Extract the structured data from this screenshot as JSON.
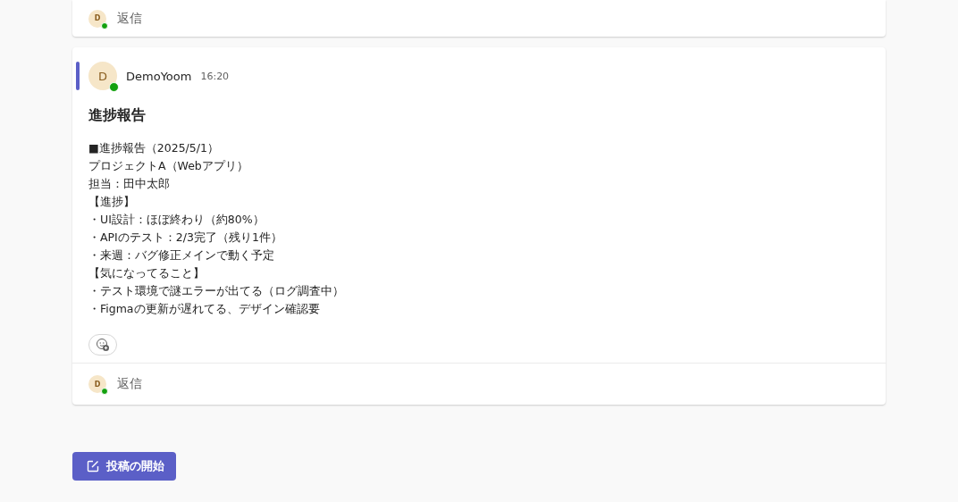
{
  "threads": [
    {
      "partial": true,
      "reply": {
        "avatar": {
          "initial": "D",
          "online": true
        },
        "label": "返信"
      }
    },
    {
      "partial": false,
      "post": {
        "accent": true,
        "avatar": {
          "initial": "D",
          "online": true
        },
        "author": "DemoYoom",
        "time": "16:20",
        "subject": "進捗報告",
        "lines": [
          "■進捗報告（2025/5/1）",
          "プロジェクトA（Webアプリ）",
          "担当：田中太郎",
          "【進捗】",
          "・UI設計：ほぼ終わり（約80%）",
          "・APIのテスト：2/3完了（残り1件）",
          "・来週：バグ修正メインで動く予定",
          "【気になってること】",
          "・テスト環境で謎エラーが出てる（ログ調査中）",
          "・Figmaの更新が遅れてる、デザイン確認要"
        ]
      },
      "reply": {
        "avatar": {
          "initial": "D",
          "online": true
        },
        "label": "返信"
      }
    }
  ],
  "new_post_button": {
    "label": "投稿の開始"
  }
}
